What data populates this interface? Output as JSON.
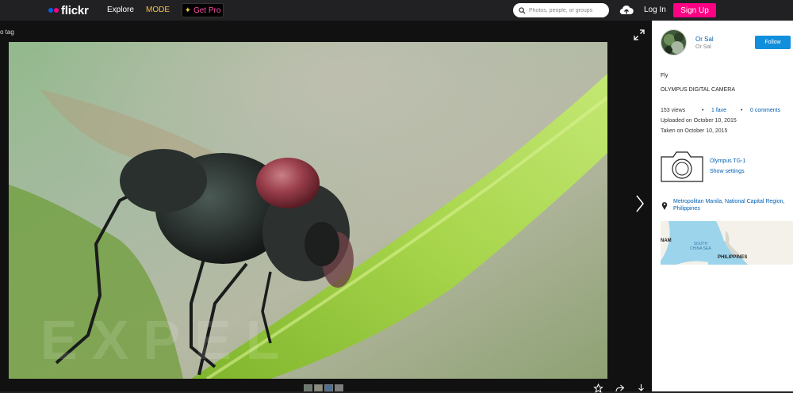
{
  "nav": {
    "logo_text": "flickr",
    "explore": "Explore",
    "mode": "MODE",
    "get_pro": "Get Pro",
    "search_placeholder": "Photos, people, or groups",
    "login": "Log In",
    "signup": "Sign Up"
  },
  "photo": {
    "back_link": "o tag",
    "thumbnails_count": 4
  },
  "sidebar": {
    "owner_name": "Or Sal",
    "owner_subtitle": "Or Sal",
    "follow_label": "Follow",
    "title": "Fly",
    "description": "OLYMPUS DIGITAL CAMERA",
    "views": "153 views",
    "faves": "1 fave",
    "comments": "0 comments",
    "uploaded": "Uploaded on October 10, 2015",
    "taken": "Taken on October 10, 2015",
    "camera_name": "Olympus TG-1",
    "show_settings": "Show settings",
    "location_line1": "Metropolitan Manila, National Capital Region,",
    "location_line2": "Philippines",
    "map_labels": {
      "country_left": "NAM",
      "sea_line1": "SOUTH",
      "sea_line2": "CHINA SEA",
      "country_right": "PHILIPPINES"
    }
  },
  "colors": {
    "brand_blue": "#0063dc",
    "brand_pink": "#ff0084",
    "follow_blue": "#128fdc",
    "link_blue": "#005fb3",
    "mode_yellow": "#f5c342"
  },
  "icons": [
    "upload-cloud-icon",
    "search-icon",
    "expand-icon",
    "next-arrow-icon",
    "star-icon",
    "share-icon",
    "download-icon",
    "camera-icon",
    "location-pin-icon"
  ]
}
